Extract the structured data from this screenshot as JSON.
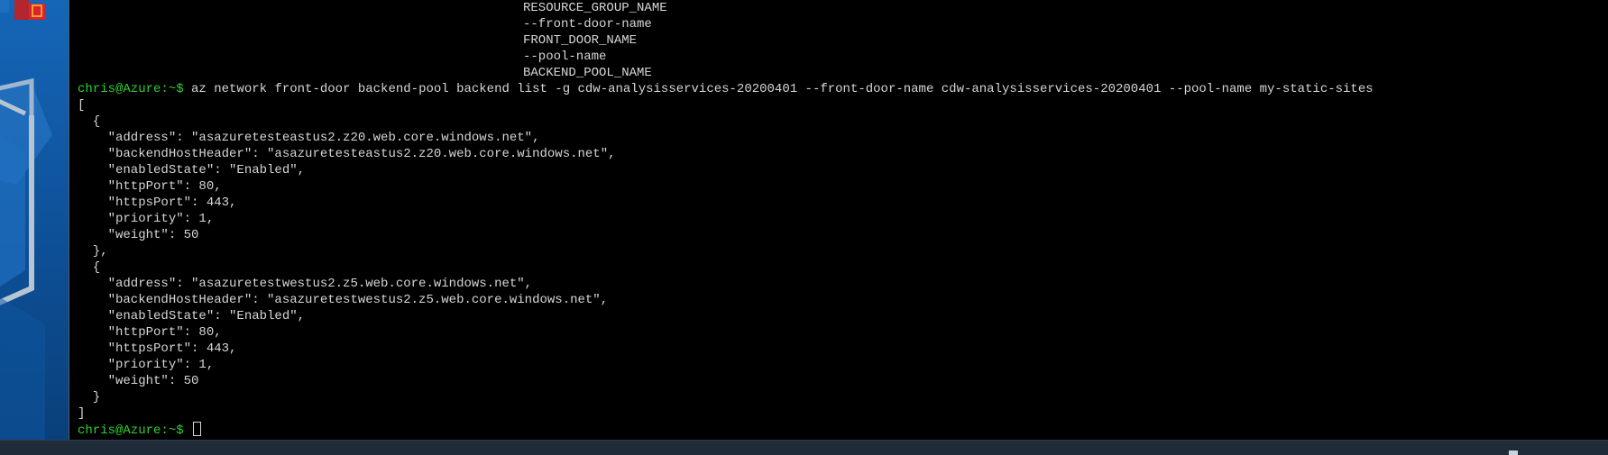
{
  "terminal": {
    "help_lines": [
      "RESOURCE_GROUP_NAME",
      "--front-door-name",
      "FRONT_DOOR_NAME",
      "--pool-name",
      "BACKEND_POOL_NAME"
    ],
    "prompt": "chris@Azure:~$",
    "command": " az network front-door backend-pool backend list -g cdw-analysisservices-20200401 --front-door-name cdw-analysisservices-20200401 --pool-name my-static-sites",
    "output_lines": [
      "[",
      "  {",
      "    \"address\": \"asazuretesteastus2.z20.web.core.windows.net\",",
      "    \"backendHostHeader\": \"asazuretesteastus2.z20.web.core.windows.net\",",
      "    \"enabledState\": \"Enabled\",",
      "    \"httpPort\": 80,",
      "    \"httpsPort\": 443,",
      "    \"priority\": 1,",
      "    \"weight\": 50",
      "  },",
      "  {",
      "    \"address\": \"asazuretestwestus2.z5.web.core.windows.net\",",
      "    \"backendHostHeader\": \"asazuretestwestus2.z5.web.core.windows.net\",",
      "    \"enabledState\": \"Enabled\",",
      "    \"httpPort\": 80,",
      "    \"httpsPort\": 443,",
      "    \"priority\": 1,",
      "    \"weight\": 50",
      "  }",
      "]"
    ],
    "final_prompt": "chris@Azure:~$"
  },
  "colors": {
    "prompt": "#2fd02f",
    "text": "#d6d6d6",
    "background": "#000000"
  }
}
